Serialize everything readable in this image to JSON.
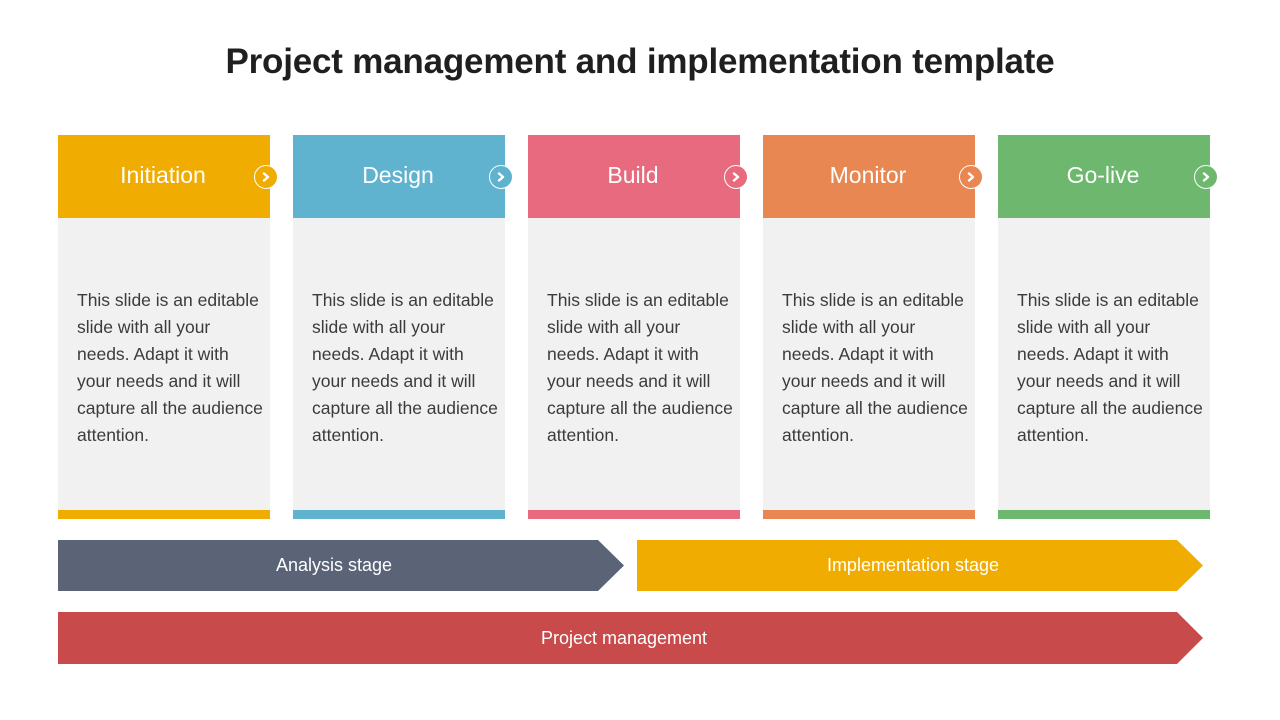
{
  "title": "Project management and implementation template",
  "stages": [
    {
      "label": "Initiation",
      "color": "#f0ac00",
      "text": "This slide is an editable slide with all your needs. Adapt it with your needs and it will capture all the audience attention.",
      "icon": "chevron-right-circle-icon"
    },
    {
      "label": "Design",
      "color": "#5fb3cf",
      "text": "This slide is an editable slide with all your needs. Adapt it with your needs and it will capture all the audience attention.",
      "icon": "chevron-right-circle-icon"
    },
    {
      "label": "Build",
      "color": "#e86a7e",
      "text": "This slide is an editable slide with all your needs. Adapt it with your needs and it will capture all the audience attention.",
      "icon": "chevron-right-circle-icon"
    },
    {
      "label": "Monitor",
      "color": "#e98752",
      "text": "This slide is an editable slide with all your needs. Adapt it with your needs and it will capture all the audience attention.",
      "icon": "chevron-right-circle-icon"
    },
    {
      "label": "Go-live",
      "color": "#6db86e",
      "text": "This slide is an editable slide with all your needs. Adapt it with your needs and it will capture all the audience attention.",
      "icon": "chevron-right-circle-icon"
    }
  ],
  "phases": {
    "analysis": {
      "label": "Analysis stage",
      "color": "#5b6377"
    },
    "implementation": {
      "label": "Implementation stage",
      "color": "#f0ac00"
    },
    "management": {
      "label": "Project management",
      "color": "#c84a4a"
    }
  }
}
